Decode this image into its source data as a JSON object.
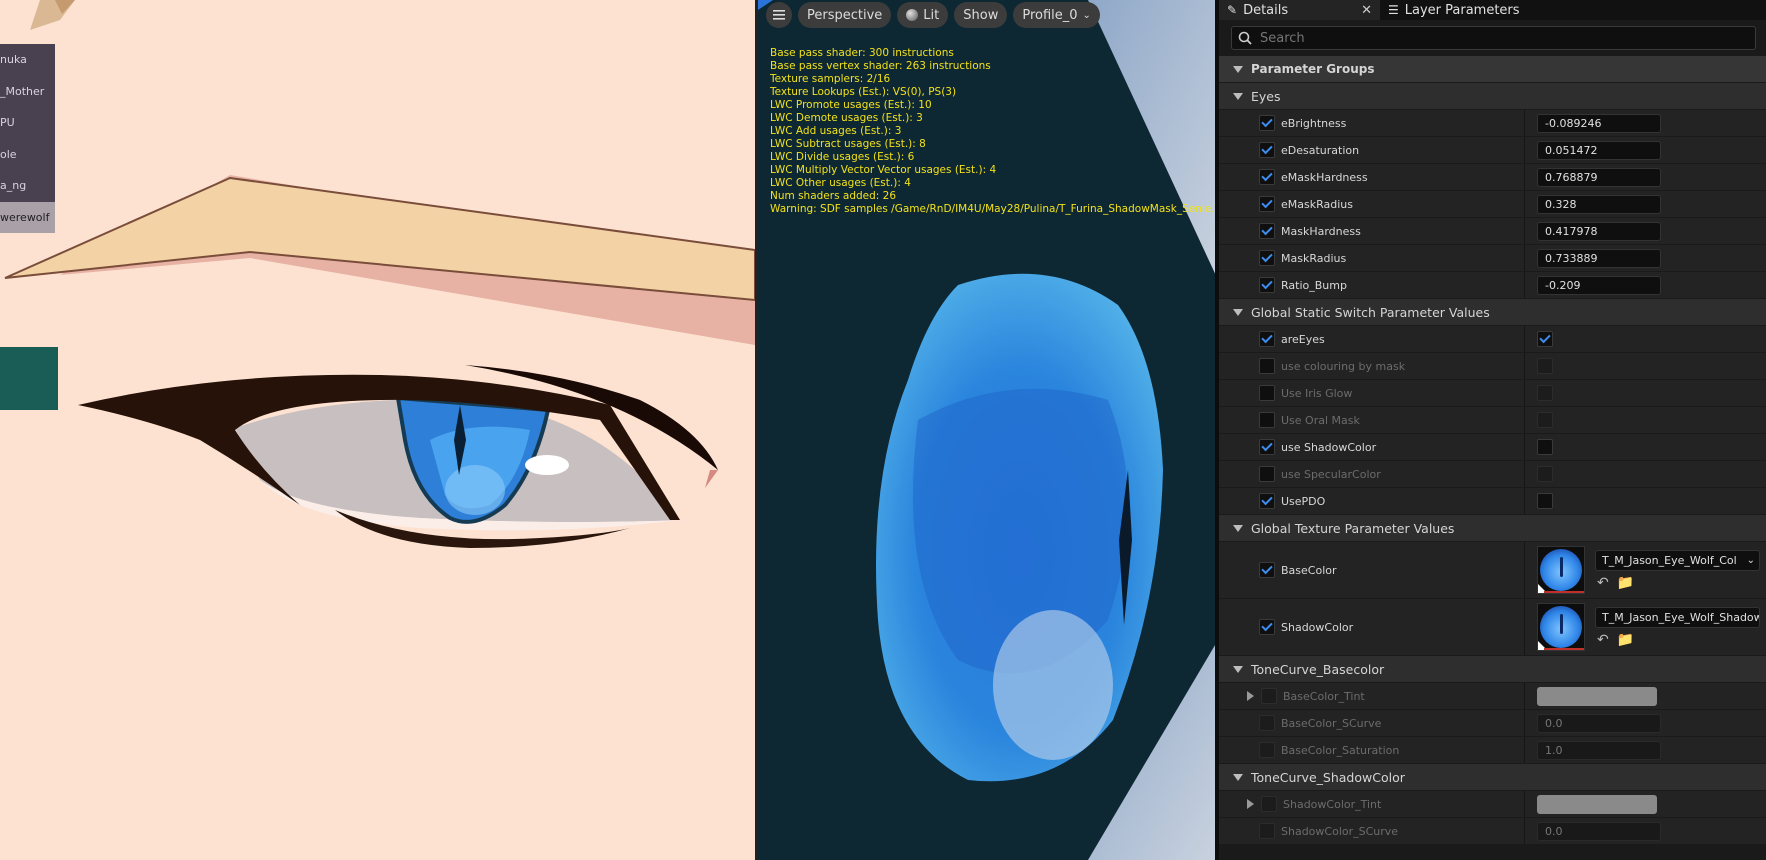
{
  "left_list": {
    "items": [
      {
        "label": "nuka"
      },
      {
        "label": "_Mother"
      },
      {
        "label": "PU"
      },
      {
        "label": "ole"
      },
      {
        "label": "a_ng"
      },
      {
        "label": "werewolf",
        "selected": true
      }
    ]
  },
  "viewport": {
    "menu_icon": "hamburger-icon",
    "perspective_label": "Perspective",
    "lit_label": "Lit",
    "show_label": "Show",
    "profile_label": "Profile_0",
    "stats": [
      "Base pass shader: 300 instructions",
      "Base pass vertex shader: 263 instructions",
      "Texture samplers: 2/16",
      "Texture Lookups (Est.): VS(0), PS(3)",
      "LWC Promote usages (Est.): 10",
      "LWC Demote usages (Est.): 3",
      "LWC Add usages (Est.): 3",
      "LWC Subtract usages (Est.): 8",
      "LWC Divide usages (Est.): 6",
      "LWC Multiply Vector Vector usages (Est.): 4",
      "LWC Other usages (Est.): 4",
      "Num shaders added: 26",
      "Warning: SDF samples /Game/RnD/IM4U/May28/Pulina/T_Furina_ShadowMask_Senie.T_Fu"
    ]
  },
  "details": {
    "tab_details": "Details",
    "tab_layers": "Layer Parameters",
    "search_placeholder": "Search",
    "parameter_groups": "Parameter Groups",
    "groups": {
      "eyes": "Eyes",
      "static_switch": "Global Static Switch Parameter Values",
      "texture": "Global Texture Parameter Values",
      "tone_base": "ToneCurve_Basecolor",
      "tone_shadow": "ToneCurve_ShadowColor"
    },
    "eyes_params": [
      {
        "name": "eBrightness",
        "value": "-0.089246"
      },
      {
        "name": "eDesaturation",
        "value": "0.051472"
      },
      {
        "name": "eMaskHardness",
        "value": "0.768879"
      },
      {
        "name": "eMaskRadius",
        "value": "0.328"
      },
      {
        "name": "MaskHardness",
        "value": "0.417978"
      },
      {
        "name": "MaskRadius",
        "value": "0.733889"
      },
      {
        "name": "Ratio_Bump",
        "value": "-0.209"
      }
    ],
    "switch_params": [
      {
        "name": "areEyes",
        "override": true,
        "value": true
      },
      {
        "name": "use colouring by mask",
        "override": false,
        "value": false
      },
      {
        "name": "Use Iris Glow",
        "override": false,
        "value": false
      },
      {
        "name": "Use Oral Mask",
        "override": false,
        "value": false
      },
      {
        "name": "use ShadowColor",
        "override": true,
        "value": false
      },
      {
        "name": "use SpecularColor",
        "override": false,
        "value": false
      },
      {
        "name": "UsePDO",
        "override": true,
        "value": false
      }
    ],
    "texture_params": [
      {
        "name": "BaseColor",
        "texture": "T_M_Jason_Eye_Wolf_Col"
      },
      {
        "name": "ShadowColor",
        "texture": "T_M_Jason_Eye_Wolf_Shadow"
      }
    ],
    "tone_base_params": {
      "tint": "BaseColor_Tint",
      "scurve": "BaseColor_SCurve",
      "scurve_value": "0.0",
      "saturation": "BaseColor_Saturation",
      "saturation_value": "1.0"
    },
    "tone_shadow_params": {
      "tint": "ShadowColor_Tint",
      "scurve": "ShadowColor_SCurve",
      "scurve_value": "0.0"
    }
  },
  "colors": {
    "accent_blue": "#3d8ef0",
    "stats_yellow": "#f2e21c",
    "skin": "#fde2d2"
  }
}
